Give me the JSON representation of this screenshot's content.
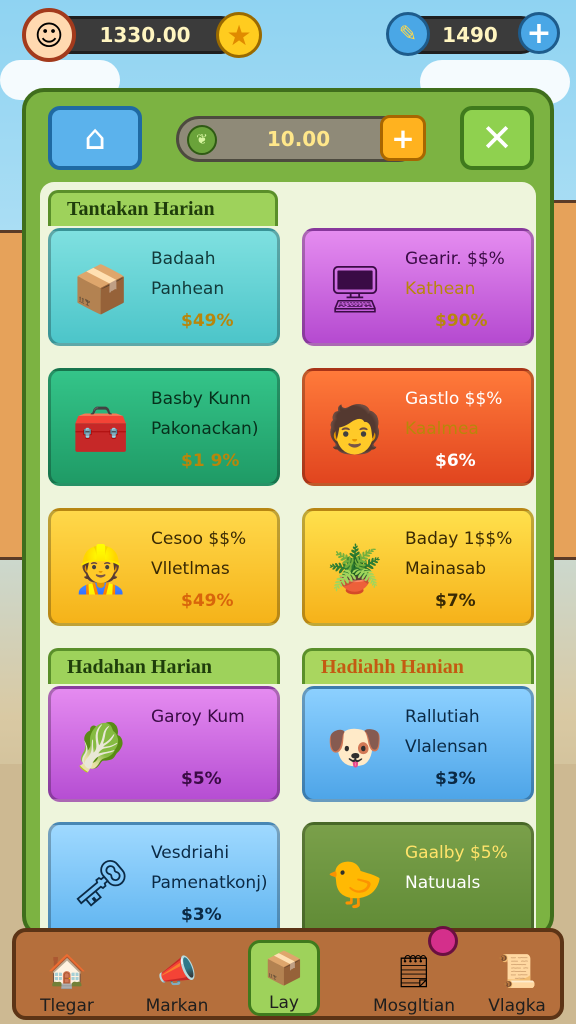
{
  "top_bar": {
    "coins": "1330.00",
    "gems": "1490"
  },
  "panel": {
    "energy": "10.00"
  },
  "sections": {
    "tab1": "Tantakan Harian",
    "tab2": "Hadahan Harian",
    "tab3": "Hadiahh Hanian"
  },
  "cards": [
    {
      "line1": "Badaah",
      "line2": "Panhean",
      "price": "$49%"
    },
    {
      "line1": "Gearir. $$%",
      "line2": "Kathean",
      "price": "$90%"
    },
    {
      "line1": "Basby Kunn",
      "line2": "Pakonackan)",
      "price": "$1 9%"
    },
    {
      "line1": "Gastlo $$%",
      "line2": "Kaalmea",
      "price": "$6%"
    },
    {
      "line1": "Cesoo $$%",
      "line2": "Vlletlmas",
      "price": "$49%"
    },
    {
      "line1": "Baday 1$$%",
      "line2": "Mainasab",
      "price": "$7%"
    },
    {
      "line1": "Garoy Kum",
      "line2": "",
      "price": "$5%"
    },
    {
      "line1": "Rallutiah",
      "line2": "Vlalensan",
      "price": "$3%"
    },
    {
      "line1": "Vesdriahi",
      "line2": "Pamenatkonj)",
      "price": "$3%"
    },
    {
      "line1": "Gaalby $5%",
      "line2": "Natuuals",
      "price": ""
    }
  ],
  "bottom_nav": [
    {
      "label": "Tlegar"
    },
    {
      "label": "Markan"
    },
    {
      "label": "Lay"
    },
    {
      "label": "Mosgltian"
    },
    {
      "label": "Vlagka"
    }
  ],
  "colors": {
    "panel_green": "#7cb342",
    "accent_orange": "#ffb21f",
    "nav_brown": "#b56f3c"
  },
  "icons": [
    "avatar-icon",
    "star-icon",
    "wrench-icon",
    "plus-icon",
    "home-icon",
    "leaf-icon",
    "close-icon",
    "house-icon",
    "megaphone-icon",
    "box-icon",
    "shop-icon",
    "scroll-icon"
  ]
}
